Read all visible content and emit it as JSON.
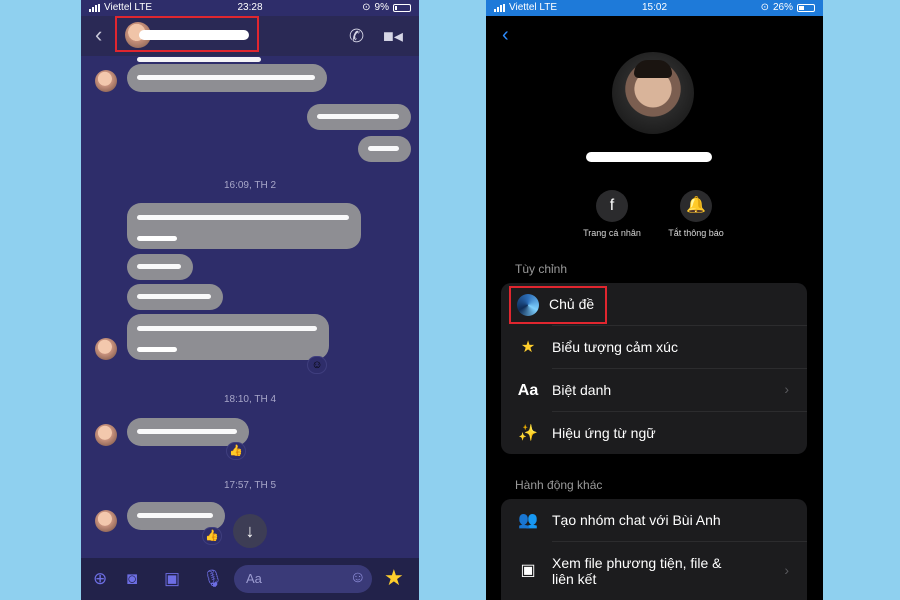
{
  "left_phone": {
    "status": {
      "carrier": "Viettel  LTE",
      "time": "23:28",
      "battery": "9%"
    },
    "timestamps": [
      "16:09, TH 2",
      "18:10, TH 4",
      "17:57, TH 5"
    ],
    "composer": {
      "placeholder": "Aa"
    }
  },
  "right_phone": {
    "status": {
      "carrier": "Viettel  LTE",
      "time": "15:02",
      "battery": "26%"
    },
    "actions": [
      {
        "label": "Trang cá nhân",
        "icon": "facebook-icon"
      },
      {
        "label": "Tắt thông báo",
        "icon": "bell-icon"
      }
    ],
    "customize": {
      "title": "Tùy chỉnh",
      "items": [
        {
          "label": "Chủ đề",
          "icon": "theme-icon"
        },
        {
          "label": "Biểu tượng cảm xúc",
          "icon": "star-icon"
        },
        {
          "label": "Biệt danh",
          "icon": "text-aa-icon"
        },
        {
          "label": "Hiệu ứng từ ngữ",
          "icon": "magic-wand-icon"
        }
      ]
    },
    "other_actions": {
      "title": "Hành động khác",
      "items": [
        {
          "label": "Tạo nhóm chat với Bùi Anh",
          "icon": "group-icon"
        },
        {
          "label": "Xem file phương tiện, file &",
          "label2": "liên kết",
          "icon": "image-icon"
        }
      ]
    }
  },
  "colors": {
    "highlight": "#e0262f",
    "messenger_accent": "#6d6ee3",
    "ios_blue": "#2d8cff"
  }
}
